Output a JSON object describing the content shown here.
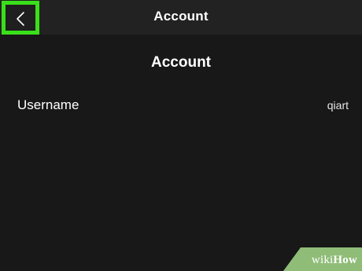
{
  "header": {
    "title": "Account",
    "back_icon": "chevron-left-icon",
    "highlight_color": "#39e01a"
  },
  "main": {
    "heading": "Account",
    "rows": [
      {
        "label": "Username",
        "value": "qiart"
      }
    ]
  },
  "watermark": {
    "part1": "wiki",
    "part2": "How"
  }
}
